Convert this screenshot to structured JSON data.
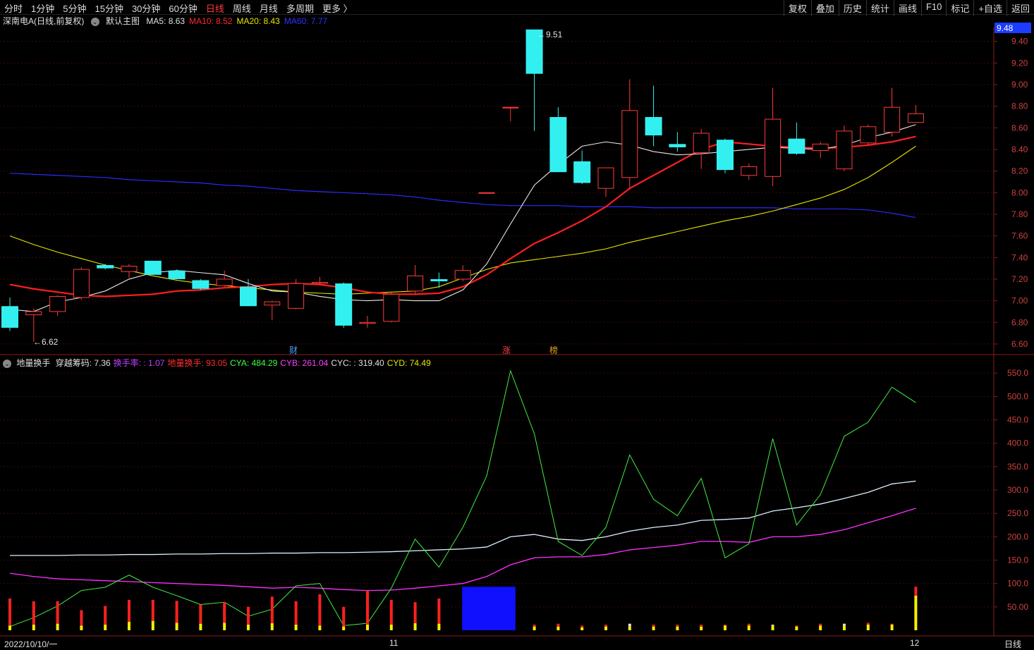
{
  "toolbar": {
    "periods": [
      "分时",
      "1分钟",
      "5分钟",
      "15分钟",
      "30分钟",
      "60分钟",
      "日线",
      "周线",
      "月线",
      "多周期",
      "更多 〉"
    ],
    "active_period": "日线",
    "actions": [
      "复权",
      "叠加",
      "历史",
      "统计",
      "画线",
      "F10",
      "标记",
      "+自选",
      "返回"
    ]
  },
  "main": {
    "stock_title": "深南电A(日线,前复权)",
    "template_label": "默认主图",
    "ma": [
      {
        "label": "MA5: 8.63",
        "color": "#e0e0e0"
      },
      {
        "label": "MA10: 8.52",
        "color": "#ff2a2a"
      },
      {
        "label": "MA20: 8.43",
        "color": "#e6e600"
      },
      {
        "label": "MA60: 7.77",
        "color": "#3030ff"
      }
    ],
    "current_price": "9.48",
    "high_label": "9.51",
    "low_label": "←6.62",
    "markers": [
      {
        "text": "财",
        "color": "#4aa0ff"
      },
      {
        "text": "涨",
        "color": "#ff4040"
      },
      {
        "text": "榜",
        "color": "#e0a020"
      }
    ],
    "yticks": [
      "9.40",
      "9.20",
      "9.00",
      "8.80",
      "8.60",
      "8.40",
      "8.20",
      "8.00",
      "7.80",
      "7.60",
      "7.40",
      "7.20",
      "7.00",
      "6.80",
      "6.60"
    ]
  },
  "indicator": {
    "name": "地量换手",
    "items": [
      {
        "label": "穿越筹码: 7.36",
        "color": "#e0e0e0"
      },
      {
        "label": "换手率: : 1.07",
        "color": "#c040ff"
      },
      {
        "label": "地量换手: 93.05",
        "color": "#ff3030"
      },
      {
        "label": "CYA: 484.29",
        "color": "#40ff40"
      },
      {
        "label": "CYB: 261.04",
        "color": "#ff40ff"
      },
      {
        "label": "CYC: : 319.40",
        "color": "#e0e0e0"
      },
      {
        "label": "CYD: 74.49",
        "color": "#e6e600"
      }
    ],
    "yticks": [
      "550.0",
      "500.0",
      "450.0",
      "400.0",
      "350.0",
      "300.0",
      "250.0",
      "200.0",
      "150.0",
      "100.0",
      "50.00"
    ]
  },
  "bottom": {
    "date_start": "2022/10/10/一",
    "month_11": "11",
    "month_12": "12",
    "period_label": "日线"
  },
  "chart_data": {
    "type": "candlestick",
    "candles": [
      {
        "o": 6.95,
        "h": 7.03,
        "l": 6.72,
        "c": 6.75
      },
      {
        "o": 6.87,
        "h": 6.93,
        "l": 6.62,
        "c": 6.9
      },
      {
        "o": 6.9,
        "h": 7.05,
        "l": 6.86,
        "c": 7.04
      },
      {
        "o": 7.03,
        "h": 7.31,
        "l": 7.01,
        "c": 7.29
      },
      {
        "o": 7.33,
        "h": 7.34,
        "l": 7.29,
        "c": 7.3
      },
      {
        "o": 7.27,
        "h": 7.34,
        "l": 7.21,
        "c": 7.32
      },
      {
        "o": 7.37,
        "h": 7.37,
        "l": 7.24,
        "c": 7.24
      },
      {
        "o": 7.28,
        "h": 7.29,
        "l": 7.2,
        "c": 7.2
      },
      {
        "o": 7.19,
        "h": 7.2,
        "l": 7.1,
        "c": 7.11
      },
      {
        "o": 7.14,
        "h": 7.28,
        "l": 7.13,
        "c": 7.2
      },
      {
        "o": 7.13,
        "h": 7.2,
        "l": 6.95,
        "c": 6.95
      },
      {
        "o": 6.96,
        "h": 7.0,
        "l": 6.82,
        "c": 6.99
      },
      {
        "o": 6.93,
        "h": 7.2,
        "l": 6.92,
        "c": 7.16
      },
      {
        "o": 7.16,
        "h": 7.22,
        "l": 7.15,
        "c": 7.17
      },
      {
        "o": 7.16,
        "h": 7.17,
        "l": 6.75,
        "c": 6.77
      },
      {
        "o": 6.79,
        "h": 6.86,
        "l": 6.75,
        "c": 6.8
      },
      {
        "o": 6.81,
        "h": 7.08,
        "l": 6.8,
        "c": 7.06
      },
      {
        "o": 7.09,
        "h": 7.33,
        "l": 7.06,
        "c": 7.23
      },
      {
        "o": 7.2,
        "h": 7.26,
        "l": 7.12,
        "c": 7.18
      },
      {
        "o": 7.2,
        "h": 7.33,
        "l": 7.18,
        "c": 7.28
      },
      {
        "o": 8.0,
        "h": 8.0,
        "l": 8.0,
        "c": 8.0
      },
      {
        "o": 8.79,
        "h": 8.79,
        "l": 8.66,
        "c": 8.79
      },
      {
        "o": 9.51,
        "h": 9.51,
        "l": 8.57,
        "c": 9.1
      },
      {
        "o": 8.7,
        "h": 8.79,
        "l": 8.19,
        "c": 8.19
      },
      {
        "o": 8.29,
        "h": 8.39,
        "l": 8.08,
        "c": 8.09
      },
      {
        "o": 8.04,
        "h": 8.23,
        "l": 7.96,
        "c": 8.23
      },
      {
        "o": 8.14,
        "h": 9.05,
        "l": 8.03,
        "c": 8.76
      },
      {
        "o": 8.7,
        "h": 8.99,
        "l": 8.43,
        "c": 8.53
      },
      {
        "o": 8.45,
        "h": 8.56,
        "l": 8.38,
        "c": 8.42
      },
      {
        "o": 8.37,
        "h": 8.59,
        "l": 8.22,
        "c": 8.55
      },
      {
        "o": 8.49,
        "h": 8.5,
        "l": 8.18,
        "c": 8.21
      },
      {
        "o": 8.16,
        "h": 8.27,
        "l": 8.12,
        "c": 8.24
      },
      {
        "o": 8.15,
        "h": 8.97,
        "l": 8.06,
        "c": 8.68
      },
      {
        "o": 8.5,
        "h": 8.65,
        "l": 8.35,
        "c": 8.36
      },
      {
        "o": 8.39,
        "h": 8.47,
        "l": 8.32,
        "c": 8.45
      },
      {
        "o": 8.22,
        "h": 8.62,
        "l": 8.2,
        "c": 8.57
      },
      {
        "o": 8.46,
        "h": 8.63,
        "l": 8.44,
        "c": 8.61
      },
      {
        "o": 8.56,
        "h": 8.97,
        "l": 8.52,
        "c": 8.79
      },
      {
        "o": 8.65,
        "h": 8.81,
        "l": 8.65,
        "c": 8.73
      }
    ],
    "ma5": [
      6.92,
      6.9,
      6.99,
      7.03,
      7.09,
      7.2,
      7.26,
      7.28,
      7.26,
      7.24,
      7.16,
      7.09,
      7.08,
      7.04,
      7.01,
      7.0,
      7.01,
      7.0,
      7.0,
      7.1,
      7.34,
      7.71,
      8.07,
      8.26,
      8.43,
      8.47,
      8.44,
      8.38,
      8.35,
      8.36,
      8.38,
      8.4,
      8.42,
      8.41,
      8.4,
      8.44,
      8.51,
      8.56,
      8.63
    ],
    "ma10": [
      7.15,
      7.11,
      7.08,
      7.05,
      7.04,
      7.05,
      7.06,
      7.09,
      7.1,
      7.12,
      7.13,
      7.15,
      7.16,
      7.15,
      7.12,
      7.08,
      7.06,
      7.06,
      7.07,
      7.13,
      7.24,
      7.39,
      7.53,
      7.63,
      7.74,
      7.87,
      8.04,
      8.16,
      8.28,
      8.4,
      8.47,
      8.45,
      8.43,
      8.42,
      8.41,
      8.42,
      8.44,
      8.47,
      8.52
    ],
    "ma20": [
      7.6,
      7.52,
      7.45,
      7.39,
      7.33,
      7.28,
      7.23,
      7.19,
      7.16,
      7.14,
      7.12,
      7.1,
      7.08,
      7.07,
      7.06,
      7.07,
      7.08,
      7.09,
      7.13,
      7.21,
      7.29,
      7.35,
      7.38,
      7.41,
      7.44,
      7.48,
      7.54,
      7.59,
      7.64,
      7.69,
      7.74,
      7.78,
      7.83,
      7.89,
      7.95,
      8.03,
      8.14,
      8.28,
      8.43
    ],
    "ma60": [
      8.18,
      8.17,
      8.16,
      8.15,
      8.14,
      8.12,
      8.11,
      8.1,
      8.09,
      8.07,
      8.06,
      8.04,
      8.02,
      8.01,
      8.0,
      7.99,
      7.98,
      7.96,
      7.93,
      7.91,
      7.89,
      7.88,
      7.88,
      7.88,
      7.87,
      7.87,
      7.87,
      7.86,
      7.86,
      7.86,
      7.86,
      7.86,
      7.86,
      7.85,
      7.85,
      7.85,
      7.84,
      7.81,
      7.77
    ],
    "cya": [
      8,
      27,
      52,
      85,
      92,
      118,
      92,
      74,
      55,
      60,
      30,
      45,
      95,
      100,
      10,
      15,
      90,
      195,
      135,
      220,
      330,
      555,
      420,
      190,
      160,
      220,
      375,
      280,
      245,
      325,
      155,
      185,
      410,
      225,
      290,
      415,
      445,
      520,
      487
    ],
    "cyb": [
      122,
      115,
      110,
      108,
      106,
      104,
      102,
      100,
      98,
      96,
      93,
      90,
      92,
      90,
      87,
      85,
      86,
      90,
      95,
      100,
      115,
      140,
      155,
      157,
      157,
      162,
      172,
      177,
      182,
      190,
      190,
      188,
      200,
      200,
      205,
      215,
      230,
      245,
      261
    ],
    "cyc": [
      160,
      160,
      160,
      161,
      161,
      162,
      162,
      163,
      163,
      164,
      164,
      165,
      165,
      166,
      166,
      167,
      168,
      170,
      172,
      174,
      178,
      200,
      205,
      195,
      192,
      200,
      212,
      220,
      225,
      235,
      237,
      240,
      255,
      262,
      270,
      282,
      295,
      313,
      319
    ],
    "cyd_high": [
      68,
      62,
      62,
      43,
      52,
      65,
      65,
      63,
      55,
      60,
      50,
      72,
      62,
      77,
      50,
      85,
      65,
      60,
      68,
      0,
      0,
      0,
      12,
      14,
      10,
      12,
      14,
      12,
      12,
      12,
      12,
      14,
      12,
      10,
      14,
      14,
      16,
      14,
      93
    ],
    "cyd_low": [
      10,
      12,
      14,
      10,
      12,
      18,
      20,
      16,
      14,
      16,
      12,
      15,
      12,
      10,
      8,
      12,
      12,
      15,
      14,
      0,
      0,
      0,
      8,
      8,
      6,
      8,
      8,
      8,
      8,
      8,
      10,
      10,
      10,
      8,
      10,
      10,
      12,
      12,
      74
    ],
    "blue_block": {
      "from": 19,
      "to": 21,
      "value": 93
    }
  }
}
